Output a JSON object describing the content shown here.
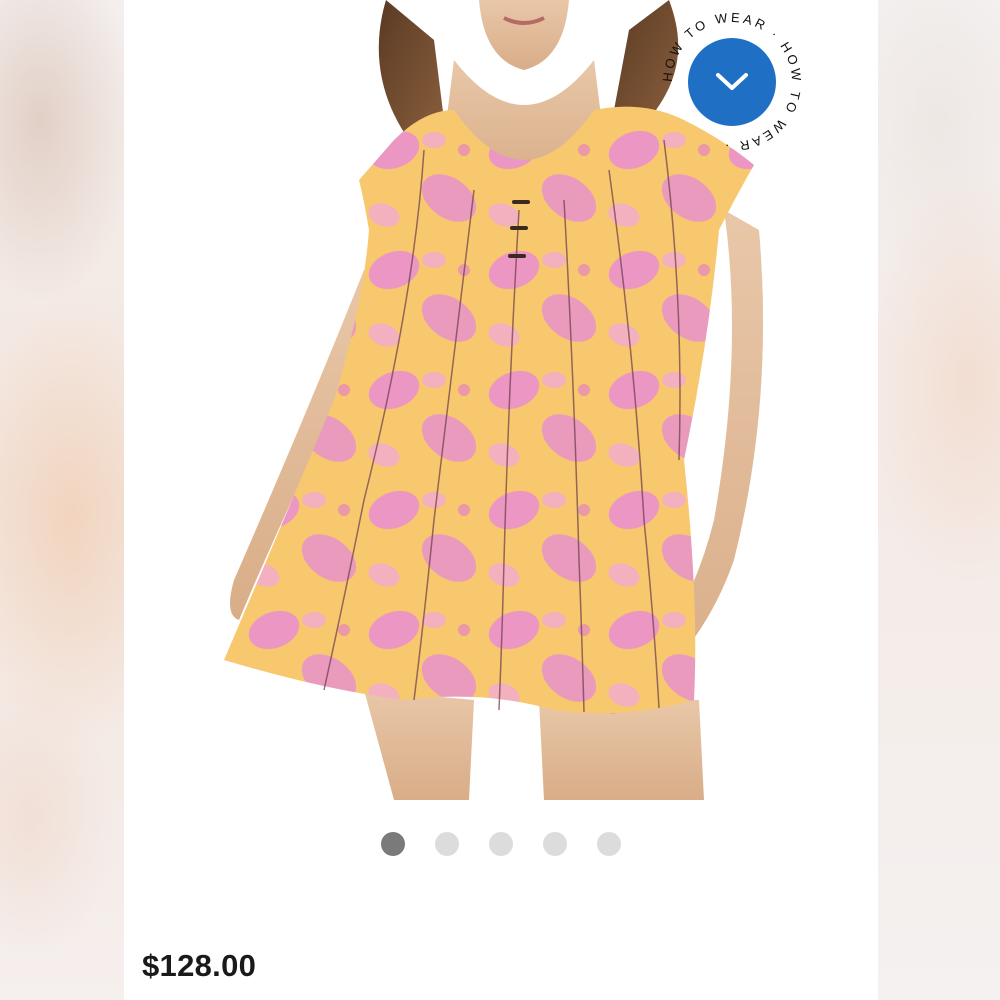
{
  "product": {
    "price": "$128.00",
    "image_alt": "Model wearing a yellow and pink floral print tunic dress",
    "dress_colors": {
      "base": "#f7c86e",
      "print": "#e48ad6",
      "stitch": "#6b3b4a"
    }
  },
  "how_to_wear": {
    "ring_text": "HOW TO WEAR · HOW TO WEAR · ",
    "button_icon": "chevron-down-icon",
    "button_color": "#1f6fc5"
  },
  "carousel": {
    "total": 5,
    "active_index": 0
  }
}
